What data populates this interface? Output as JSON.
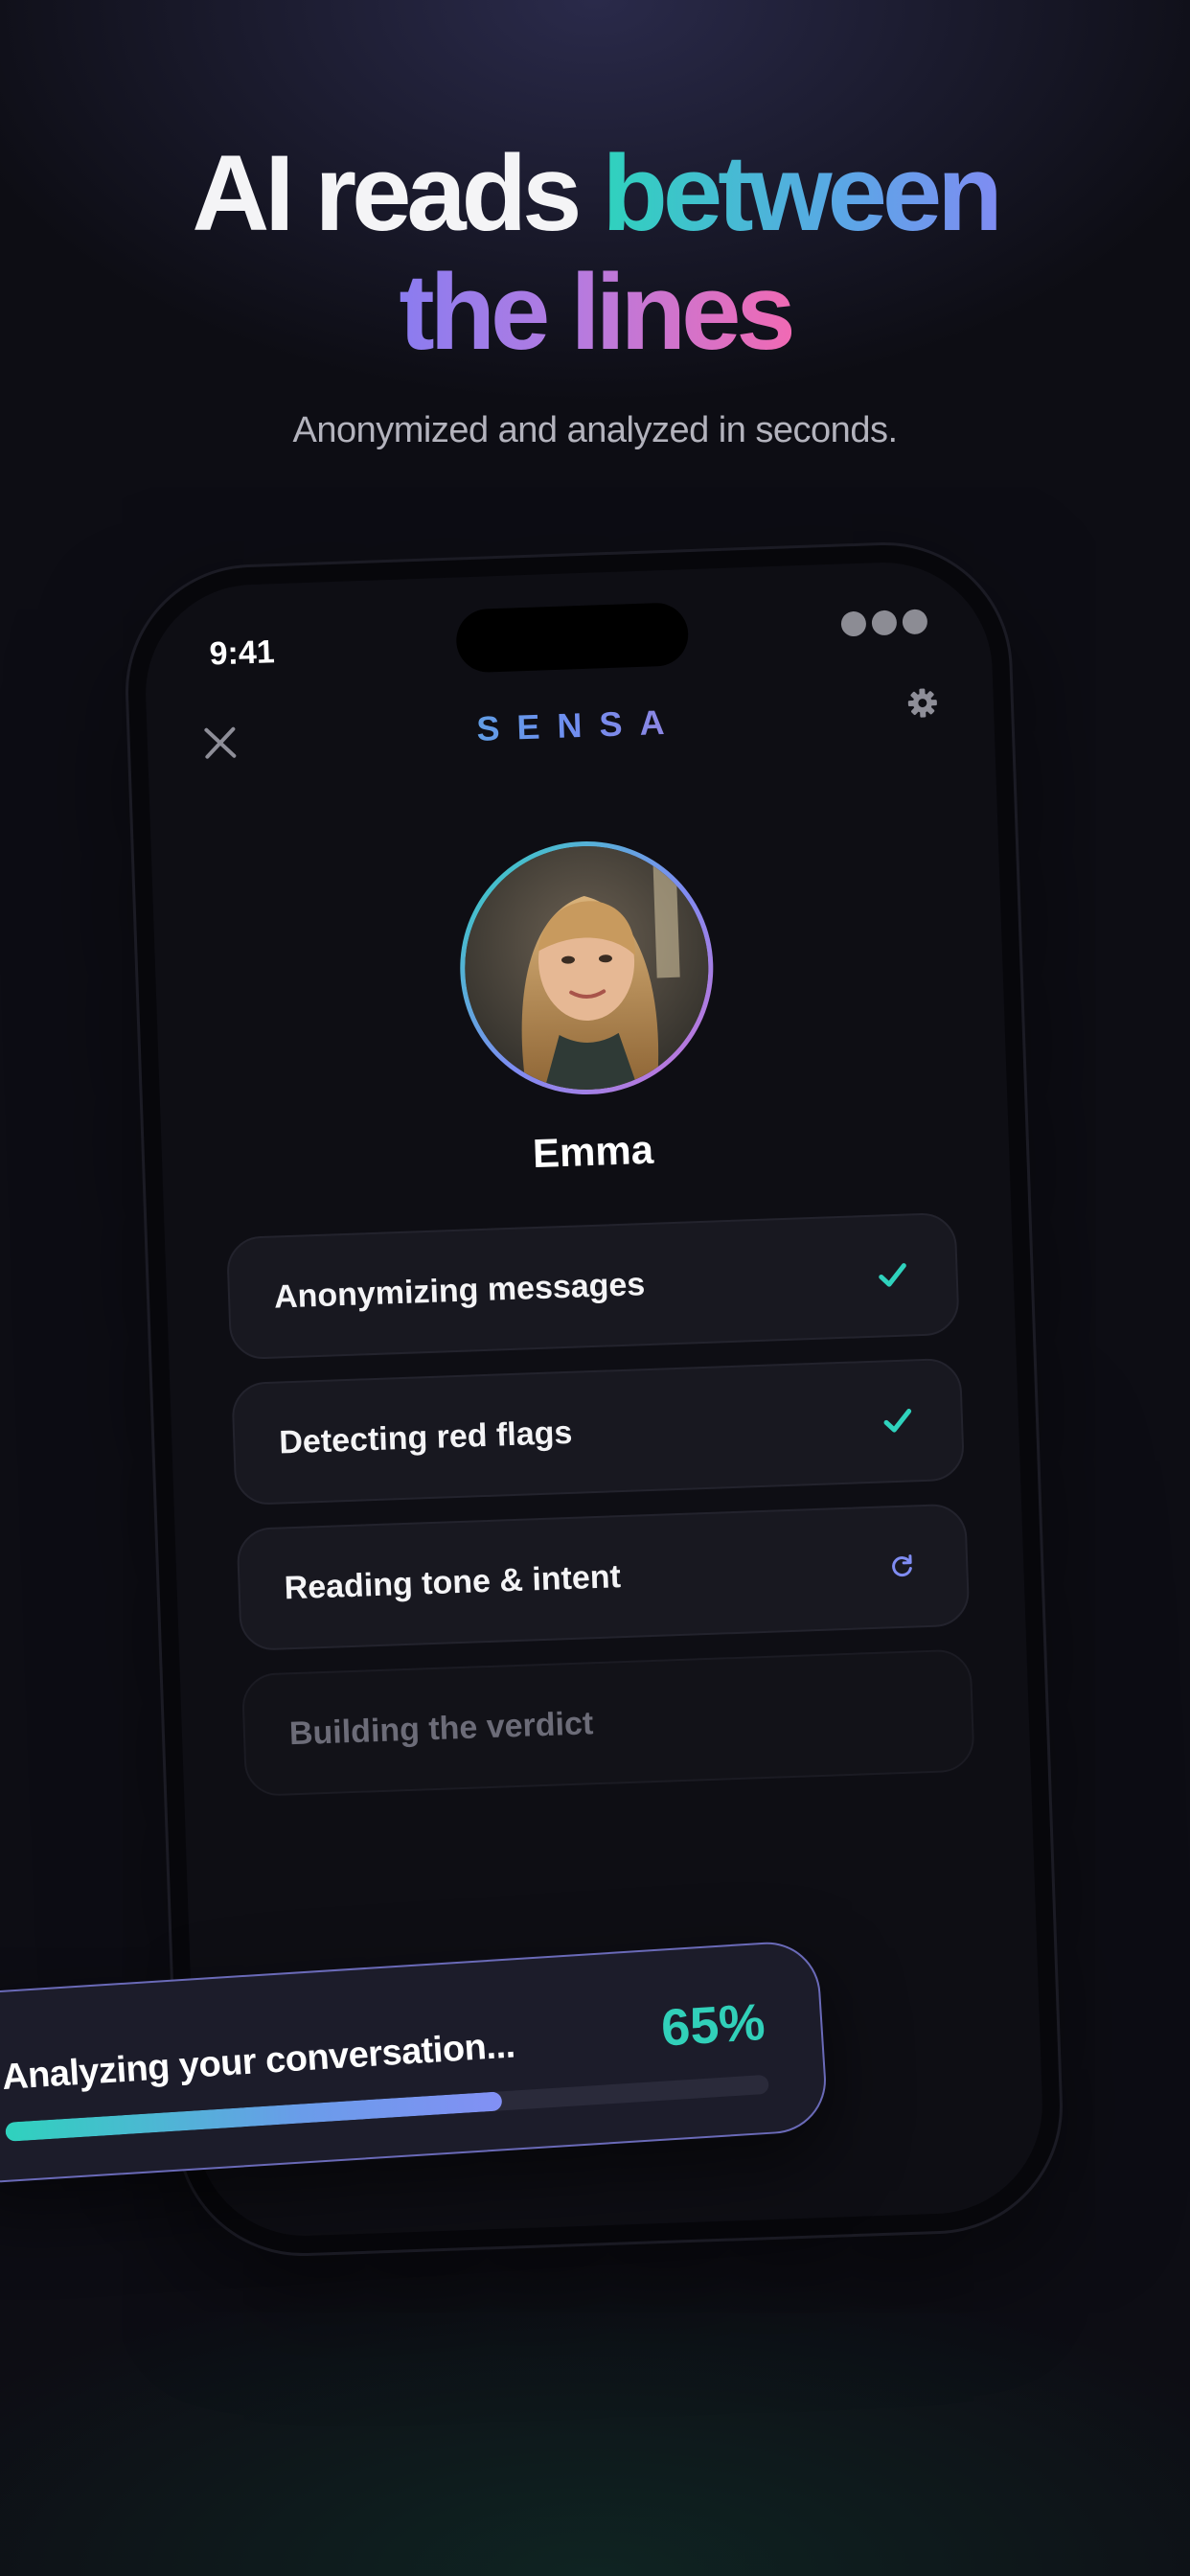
{
  "hero": {
    "headline_part1": "AI reads ",
    "headline_part2": "between",
    "headline_part3": "the lines",
    "subtitle": "Anonymized and analyzed in seconds."
  },
  "status_bar": {
    "time": "9:41"
  },
  "app": {
    "brand": "SENSA",
    "close_icon": "close-icon",
    "settings_icon": "gear-icon"
  },
  "profile": {
    "name": "Emma",
    "avatar": "profile-photo"
  },
  "steps": [
    {
      "label": "Anonymizing messages",
      "status": "done",
      "icon": "check-icon"
    },
    {
      "label": "Detecting red flags",
      "status": "done",
      "icon": "check-icon"
    },
    {
      "label": "Reading tone & intent",
      "status": "in-progress",
      "icon": "refresh-icon"
    },
    {
      "label": "Building the verdict",
      "status": "pending",
      "icon": ""
    }
  ],
  "progress": {
    "label": "Analyzing your conversation...",
    "percent_label": "65%",
    "value": 0.65
  },
  "colors": {
    "background": "#0d0d14",
    "accent_teal": "#2fd2bd",
    "accent_violet": "#7f8cf2",
    "accent_pink": "#f06ab4",
    "card": "#181820"
  }
}
